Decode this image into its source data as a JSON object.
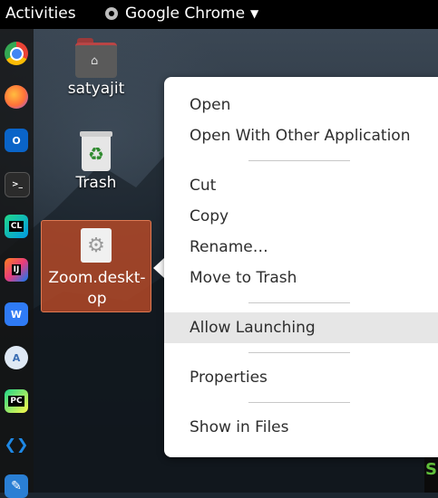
{
  "topbar": {
    "activities": "Activities",
    "app_name": "Google Chrome",
    "caret": "▼"
  },
  "dock": {
    "items": [
      {
        "icon": "chrome-icon",
        "color": "#4285f4"
      },
      {
        "icon": "firefox-icon",
        "color": "#ff7139"
      },
      {
        "icon": "outlook-icon",
        "color": "#0a64c8",
        "glyph": "O"
      },
      {
        "icon": "terminal-icon",
        "color": "#2b2b2b",
        "glyph": ">_"
      },
      {
        "icon": "clion-icon",
        "color": "#1c9b6c",
        "glyph": "CL"
      },
      {
        "icon": "intellij-icon",
        "color": "#e93c7c",
        "glyph": "IJ"
      },
      {
        "icon": "wps-icon",
        "color": "#2f7bf5",
        "glyph": "W"
      },
      {
        "icon": "app-a-icon",
        "color": "#3a6db3",
        "glyph": "A"
      },
      {
        "icon": "pycharm-icon",
        "color": "#21d789",
        "glyph": "PC"
      },
      {
        "icon": "vscode-icon",
        "color": "#1e88e5",
        "glyph": "❮❯"
      },
      {
        "icon": "text-editor-icon",
        "color": "#2a7fd4",
        "glyph": "✎"
      }
    ]
  },
  "desktop": {
    "home_folder_label": "satyajit",
    "trash_label": "Trash",
    "zoom_label_line1": "Zoom.deskt-",
    "zoom_label_line2": "op",
    "trash_glyph": "♻",
    "gear_glyph": "⚙"
  },
  "context_menu": {
    "groups": [
      [
        "Open",
        "Open With Other Application"
      ],
      [
        "Cut",
        "Copy",
        "Rename…",
        "Move to Trash"
      ],
      [
        "Allow Launching"
      ],
      [
        "Properties"
      ],
      [
        "Show in Files"
      ]
    ],
    "highlighted": "Allow Launching"
  },
  "corner_glyph": "S"
}
